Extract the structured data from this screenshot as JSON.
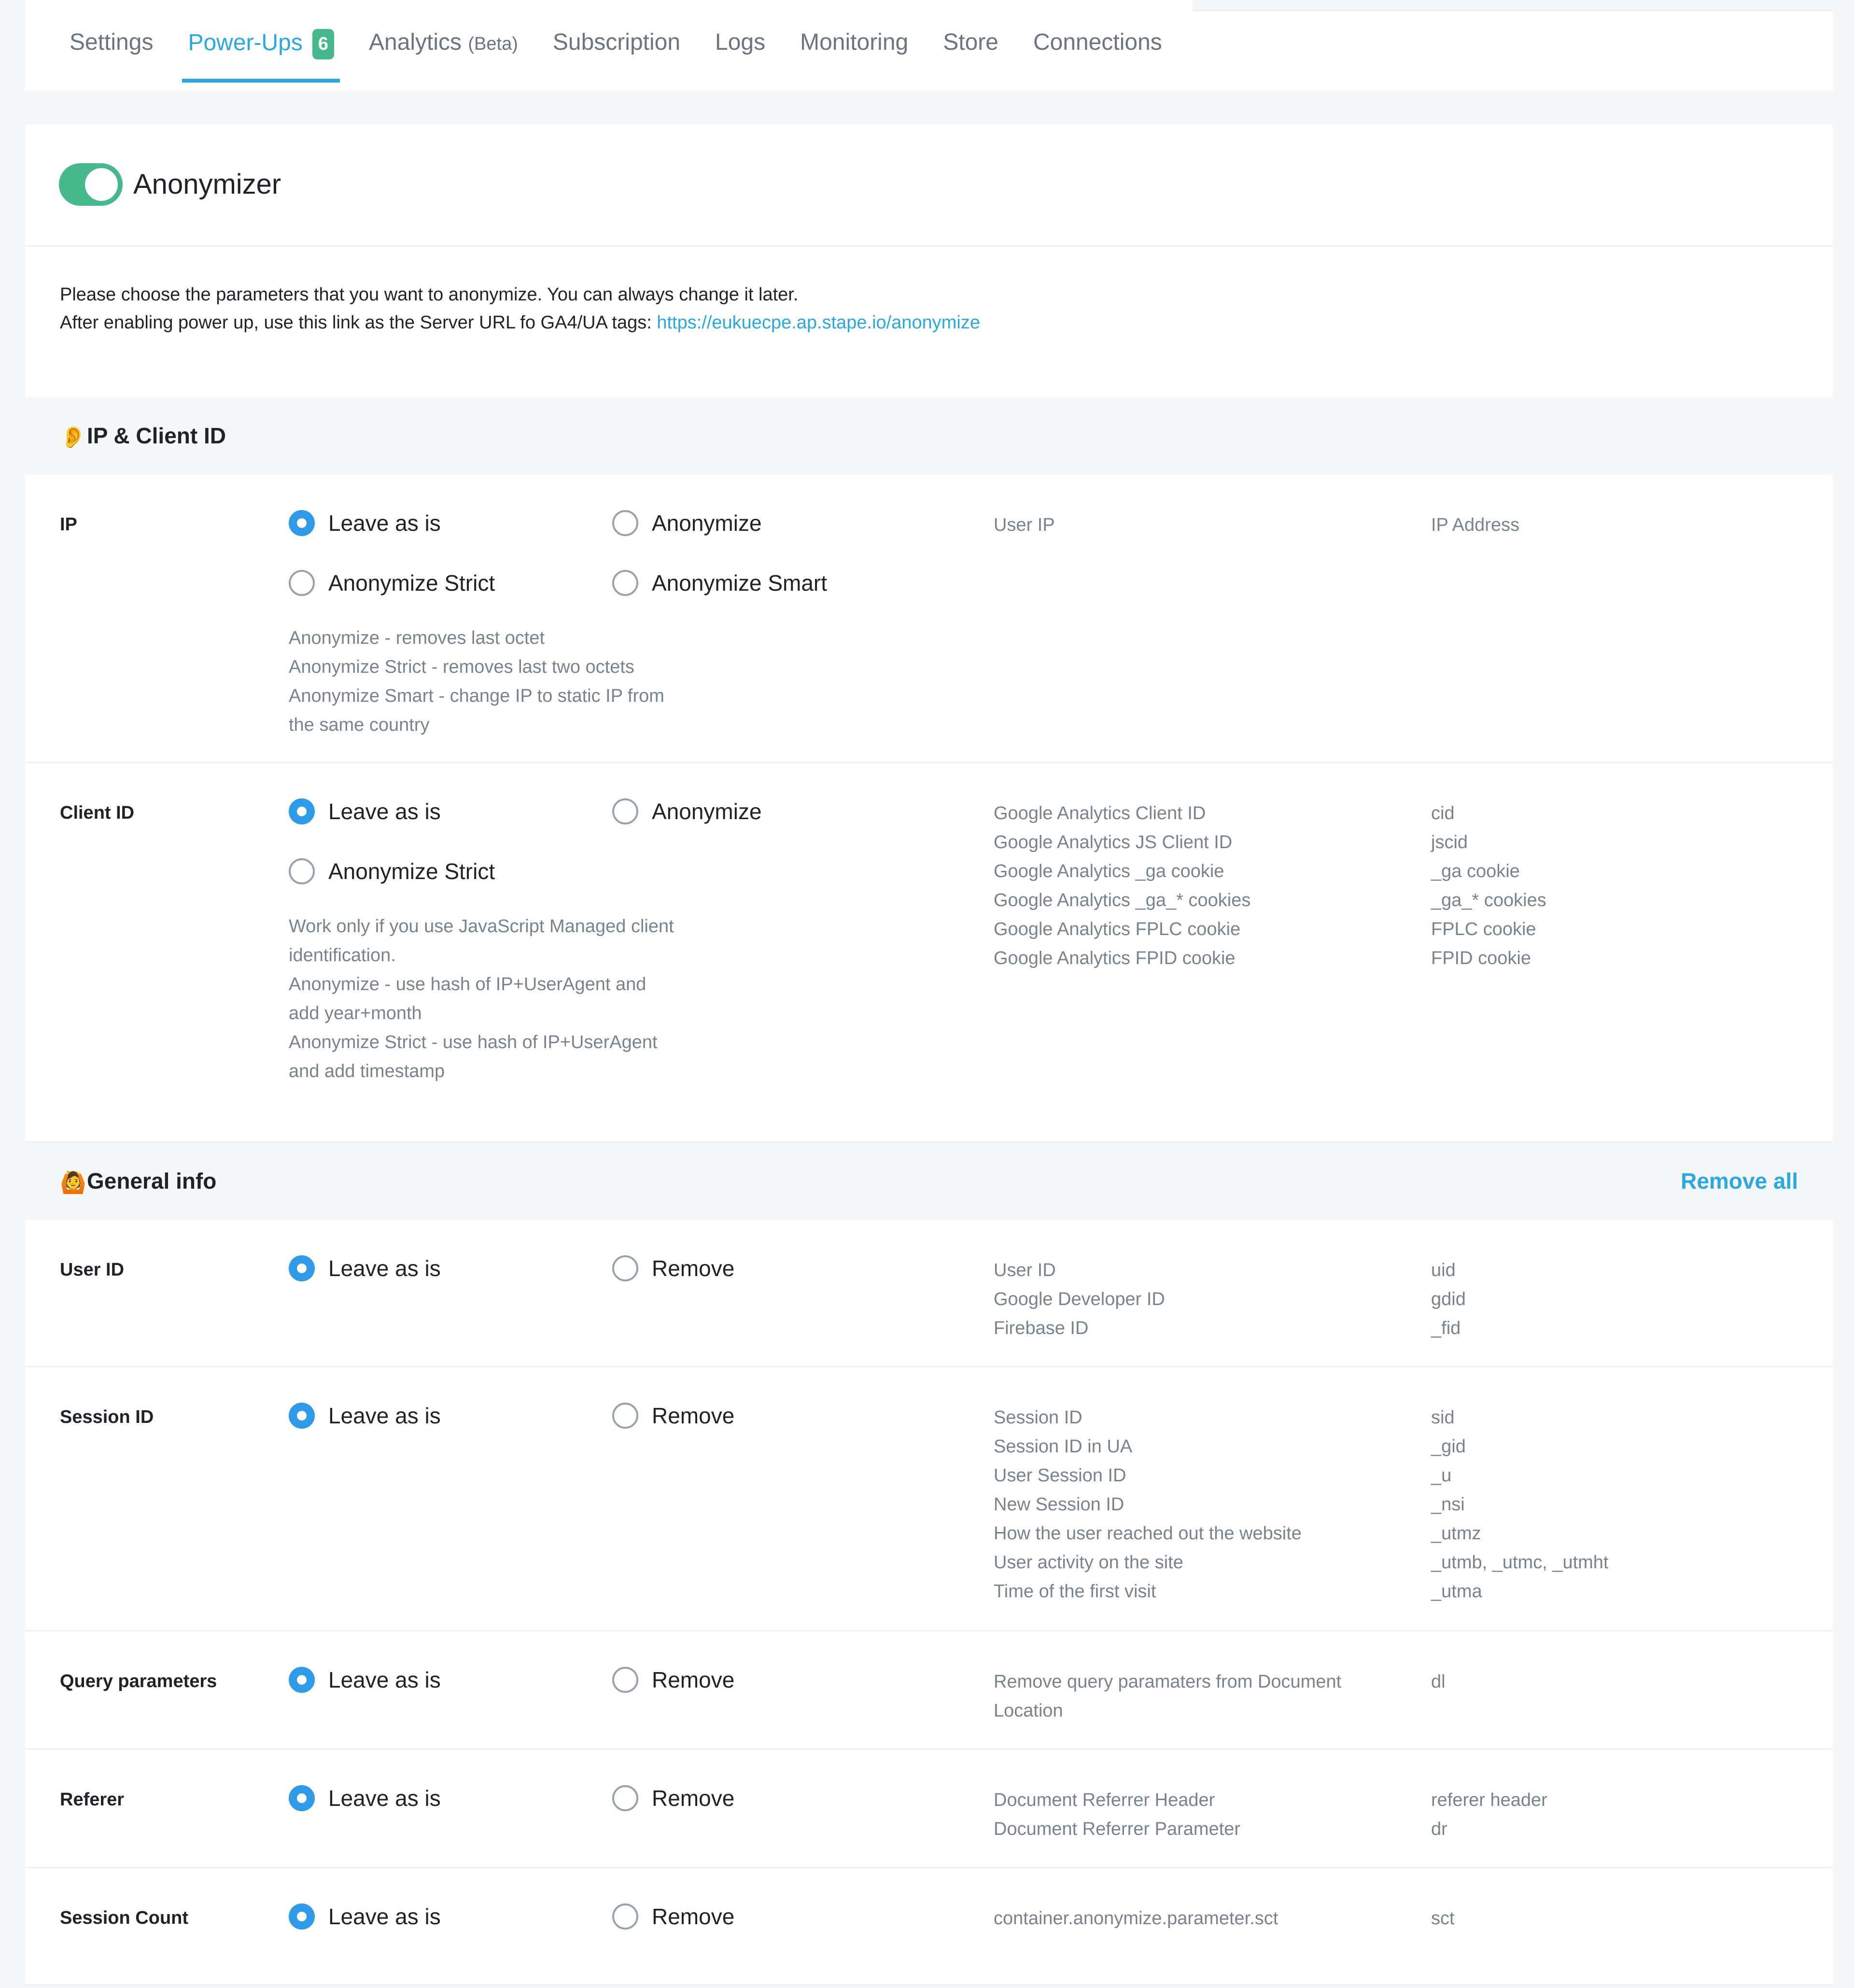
{
  "tabs": [
    {
      "label": "Settings"
    },
    {
      "label": "Power-Ups",
      "badge": "6"
    },
    {
      "label": "Analytics",
      "suffix": "(Beta)"
    },
    {
      "label": "Subscription"
    },
    {
      "label": "Logs"
    },
    {
      "label": "Monitoring"
    },
    {
      "label": "Store"
    },
    {
      "label": "Connections"
    }
  ],
  "header": {
    "title": "Anonymizer"
  },
  "intro": {
    "line1": "Please choose the parameters that you want to anonymize. You can always change it later.",
    "line2_prefix": "After enabling power up, use this link as the Server URL fo GA4/UA tags: ",
    "link": "https://eukuecpe.ap.stape.io/anonymize"
  },
  "sections": {
    "ip_client": {
      "title": "IP & Client ID",
      "icon": "ear-icon"
    },
    "general": {
      "title": "General info",
      "icon": "person-icon",
      "action": "Remove all"
    }
  },
  "options": {
    "leave": "Leave as is",
    "anonymize": "Anonymize",
    "strict": "Anonymize Strict",
    "smart": "Anonymize Smart",
    "remove": "Remove"
  },
  "ip": {
    "label": "IP",
    "notes": [
      "Anonymize - removes last octet",
      "Anonymize Strict - removes last two octets",
      "Anonymize Smart - change IP to static IP from",
      "the same country"
    ],
    "desc": [
      "User IP"
    ],
    "keys": [
      "IP Address"
    ]
  },
  "client_id": {
    "label": "Client ID",
    "notes": [
      "Work only if you use JavaScript Managed client",
      "identification.",
      "Anonymize - use hash of IP+UserAgent and",
      "add year+month",
      "Anonymize Strict - use hash of IP+UserAgent",
      "and add timestamp"
    ],
    "desc": [
      "Google Analytics Client ID",
      "Google Analytics JS Client ID",
      "Google Analytics _ga cookie",
      "Google Analytics _ga_* cookies",
      "Google Analytics FPLC cookie",
      "Google Analytics FPID cookie"
    ],
    "keys": [
      "cid",
      "jscid",
      "_ga cookie",
      "_ga_* cookies",
      "FPLC cookie",
      "FPID cookie"
    ]
  },
  "user_id": {
    "label": "User ID",
    "desc": [
      "User ID",
      "Google Developer ID",
      "Firebase ID"
    ],
    "keys": [
      "uid",
      "gdid",
      "_fid"
    ]
  },
  "session_id": {
    "label": "Session ID",
    "desc": [
      "Session ID",
      "Session ID in UA",
      "User Session ID",
      "New Session ID",
      "How the user reached out the website",
      "User activity on the site",
      "Time of the first visit"
    ],
    "keys": [
      "sid",
      "_gid",
      "_u",
      "_nsi",
      "_utmz",
      "_utmb, _utmc, _utmht",
      "_utma"
    ]
  },
  "query": {
    "label": "Query parameters",
    "desc": [
      "Remove query paramaters from Document",
      "Location"
    ],
    "keys": [
      "dl"
    ]
  },
  "referer": {
    "label": "Referer",
    "desc": [
      "Document Referrer Header",
      "Document Referrer Parameter"
    ],
    "keys": [
      "referer header",
      "dr"
    ]
  },
  "session_count": {
    "label": "Session Count",
    "desc": [
      "container.anonymize.parameter.sct"
    ],
    "keys": [
      "sct"
    ]
  },
  "colors": {
    "accent": "#2aa8df",
    "toggle": "#46b98c",
    "radio": "#2e9ae8",
    "muted": "#7a838d"
  }
}
